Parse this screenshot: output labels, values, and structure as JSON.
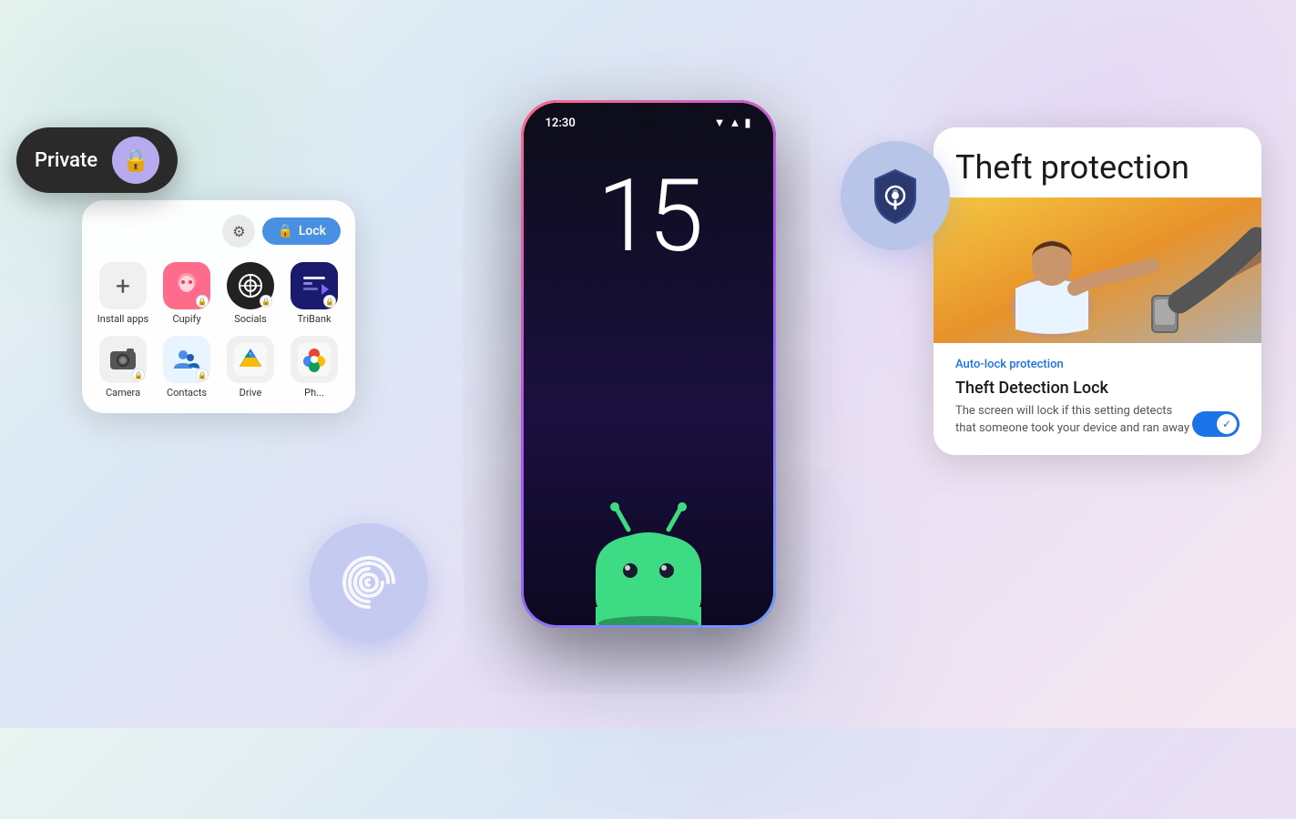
{
  "background": {
    "color_start": "#e8f4f0",
    "color_end": "#f5e8f0"
  },
  "phone": {
    "status_time": "12:30",
    "clock": "15"
  },
  "private_card": {
    "label": "Private",
    "icon": "🔒"
  },
  "app_drawer": {
    "lock_button": "Lock",
    "apps": [
      {
        "name": "Install apps",
        "row": 1
      },
      {
        "name": "Cupify",
        "row": 1
      },
      {
        "name": "Socials",
        "row": 1
      },
      {
        "name": "TriBank",
        "row": 1
      },
      {
        "name": "Camera",
        "row": 2
      },
      {
        "name": "Contacts",
        "row": 2
      },
      {
        "name": "Drive",
        "row": 2
      },
      {
        "name": "Ph...",
        "row": 2
      }
    ]
  },
  "theft_card": {
    "title": "Theft protection",
    "auto_lock_label": "Auto-lock protection",
    "detection_title": "Theft Detection Lock",
    "detection_desc": "The screen will lock if this setting detects that someone took your device and ran away",
    "toggle_state": true
  }
}
